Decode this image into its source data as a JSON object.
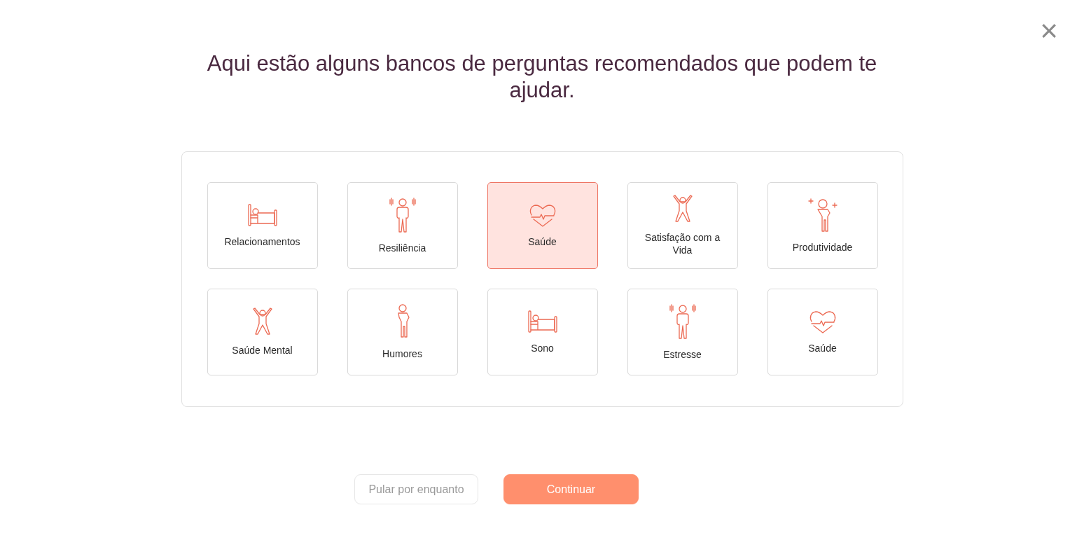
{
  "close_button": "×",
  "title": "Aqui estão alguns bancos de perguntas recomendados que podem te ajudar.",
  "cards": [
    {
      "label": "Relacionamentos",
      "kind": "bed",
      "selected": false
    },
    {
      "label": "Resiliência",
      "kind": "vibrate",
      "selected": false
    },
    {
      "label": "Saúde",
      "kind": "heart",
      "selected": true
    },
    {
      "label": "Satisfação com a Vida",
      "kind": "cheer",
      "selected": false
    },
    {
      "label": "Produtividade",
      "kind": "plus",
      "selected": false
    },
    {
      "label": "Saúde Mental",
      "kind": "cheer",
      "selected": false
    },
    {
      "label": "Humores",
      "kind": "hips",
      "selected": false
    },
    {
      "label": "Sono",
      "kind": "bed",
      "selected": false
    },
    {
      "label": "Estresse",
      "kind": "vibrate",
      "selected": false
    },
    {
      "label": "Saúde",
      "kind": "heart",
      "selected": false
    }
  ],
  "buttons": [
    {
      "label": "Pular por enquanto",
      "kind": "secondary",
      "disabled": true
    },
    {
      "label": "Continuar",
      "kind": "primary",
      "disabled": false
    }
  ]
}
